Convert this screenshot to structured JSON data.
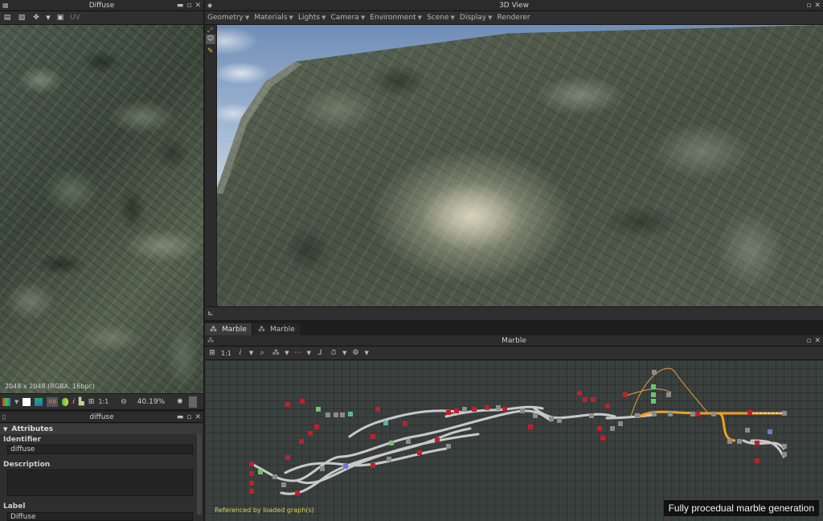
{
  "diffuse_panel": {
    "title": "Diffuse",
    "toolbar_uv": "UV",
    "resolution_text": "2048 x 2048 (RGBA, 16bpc)",
    "zoom_level": "40.19%",
    "one_to_one": "1:1"
  },
  "attributes_panel": {
    "title": "diffuse",
    "section": "Attributes",
    "identifier_label": "Identifier",
    "identifier_value": "diffuse",
    "description_label": "Description",
    "description_value": "",
    "label_label": "Label",
    "label_value": "Diffuse"
  },
  "view3d": {
    "title": "3D View",
    "menus": [
      "Geometry",
      "Materials",
      "Lights",
      "Camera",
      "Environment",
      "Scene",
      "Display",
      "Renderer"
    ]
  },
  "graph": {
    "tabs": [
      "Marble",
      "Marble"
    ],
    "title": "Marble",
    "toolbar_ratio": "1:1",
    "status_text": "Referenced by loaded graph(s)",
    "caption": "Fully procedual marble generation"
  },
  "colors": {
    "accent_orange": "#f0a020",
    "status_yellow": "#d8d050",
    "node_red": "#c0202a"
  }
}
